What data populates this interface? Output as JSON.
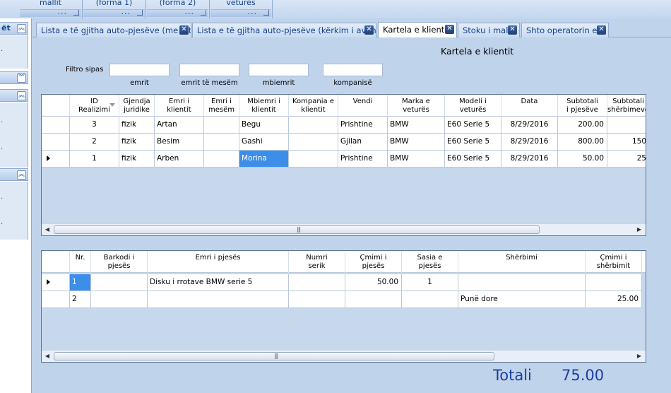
{
  "ribbon": {
    "groups": [
      {
        "label": "mallit"
      },
      {
        "label": "(forma 1)"
      },
      {
        "label": "(forma 2)"
      },
      {
        "label": "veturës"
      }
    ],
    "dots": "..."
  },
  "nav": {
    "top_text": "ët",
    "dot": "."
  },
  "tabs": [
    {
      "label": "Lista e të gjitha auto-pjesëve (me foto)",
      "close": "✕"
    },
    {
      "label": "Lista e të gjitha auto-pjesëve (kërkim i avansuar)",
      "close": "✕"
    },
    {
      "label": "Kartela e klientit",
      "close": "✕"
    },
    {
      "label": "Stoku i mallit",
      "close": "✕"
    },
    {
      "label": "Shto operatorin e ri",
      "close": "✕"
    }
  ],
  "form": {
    "title": "Kartela e klientit",
    "filter_label": "Filtro sipas",
    "filters": [
      {
        "caption": "emrit",
        "value": ""
      },
      {
        "caption": "emrit të mesëm",
        "value": ""
      },
      {
        "caption": "mbiemrit",
        "value": ""
      },
      {
        "caption": "kompanisë",
        "value": ""
      }
    ]
  },
  "grid1": {
    "columns": [
      {
        "line1": "ID",
        "line2": "Realizimi"
      },
      {
        "line1": "Gjendja",
        "line2": "juridike"
      },
      {
        "line1": "Emri i",
        "line2": "klientit"
      },
      {
        "line1": "Emri i",
        "line2": "mesëm"
      },
      {
        "line1": "Mbiemri i",
        "line2": "klientit"
      },
      {
        "line1": "Kompania e",
        "line2": "klientit"
      },
      {
        "line1": "Vendi",
        "line2": ""
      },
      {
        "line1": "Marka e",
        "line2": "veturës"
      },
      {
        "line1": "Modeli i",
        "line2": "veturës"
      },
      {
        "line1": "Data",
        "line2": ""
      },
      {
        "line1": "Subtotali",
        "line2": "i pjesëve"
      },
      {
        "line1": "Subtotali",
        "line2": "shërbimeve"
      }
    ],
    "rows": [
      {
        "cells": [
          "3",
          "fizik",
          "Artan",
          "",
          "Begu",
          "",
          "Prishtine",
          "BMW",
          "E60 Serie 5",
          "8/29/2016",
          "200.00",
          ""
        ]
      },
      {
        "cells": [
          "2",
          "fizik",
          "Besim",
          "",
          "Gashi",
          "",
          "Gjilan",
          "BMW",
          "E60 Serie 5",
          "8/29/2016",
          "800.00",
          "150"
        ]
      },
      {
        "cells": [
          "1",
          "fizik",
          "Arben",
          "",
          "Morina",
          "",
          "Prishtine",
          "BMW",
          "E60 Serie 5",
          "8/29/2016",
          "50.00",
          "25"
        ]
      }
    ],
    "current_row": 2,
    "selected_cell": "Morina"
  },
  "grid2": {
    "columns": [
      {
        "line1": "Nr.",
        "line2": ""
      },
      {
        "line1": "Barkodi i",
        "line2": "pjesës"
      },
      {
        "line1": "Emri i pjesës",
        "line2": ""
      },
      {
        "line1": "Numri",
        "line2": "serik"
      },
      {
        "line1": "Çmimi i",
        "line2": "pjesës"
      },
      {
        "line1": "Sasia e",
        "line2": "pjesës"
      },
      {
        "line1": "Shërbimi",
        "line2": ""
      },
      {
        "line1": "Çmimi i",
        "line2": "shërbimit"
      }
    ],
    "rows": [
      {
        "cells": [
          "1",
          "",
          "Disku i rrotave BMW serie 5",
          "",
          "50.00",
          "1",
          "",
          ""
        ]
      },
      {
        "cells": [
          "2",
          "",
          "",
          "",
          "",
          "",
          "Punë dore",
          "25.00"
        ]
      }
    ],
    "current_row": 0
  },
  "scroll": {
    "grip": "|||"
  },
  "totals": {
    "label": "Totali",
    "value": "75.00"
  },
  "colors": {
    "accent": "#15428b",
    "selection": "#3d8ee8",
    "total_text": "#1a3fa0"
  }
}
